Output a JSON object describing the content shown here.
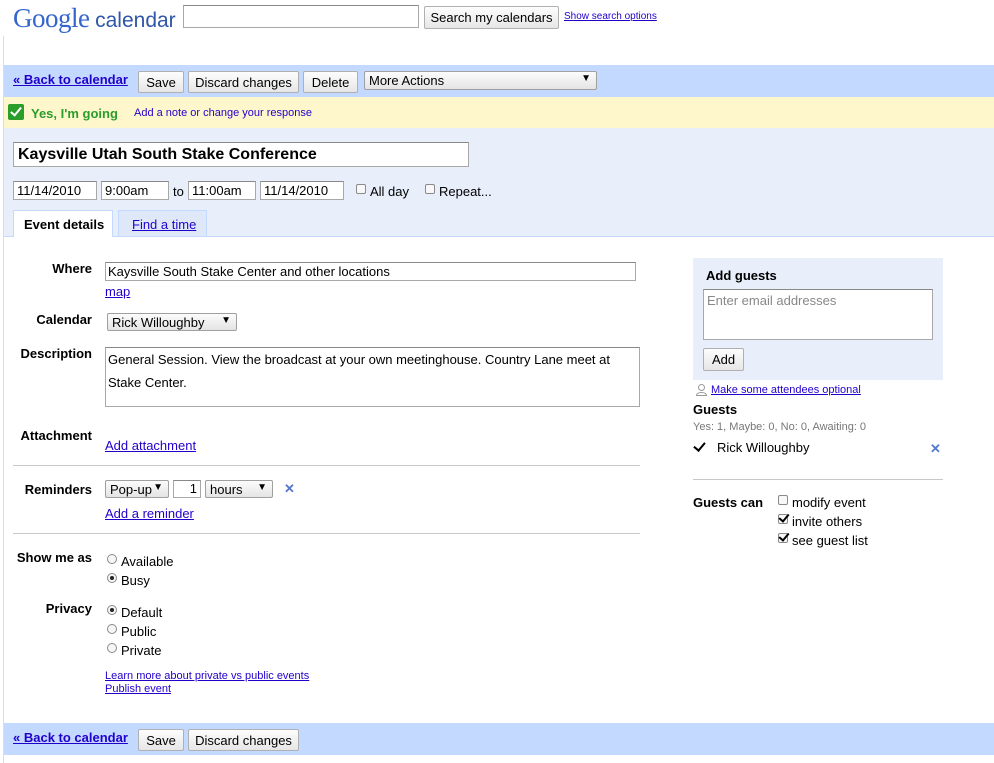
{
  "header": {
    "logo_google": "Google",
    "logo_calendar": "calendar",
    "search_value": "",
    "search_button": "Search my calendars",
    "show_search_options": "Show search options"
  },
  "toolbar": {
    "back": "« Back to calendar",
    "save": "Save",
    "discard": "Discard changes",
    "delete": "Delete",
    "more_actions": "More Actions"
  },
  "response": {
    "status": "Yes, I'm going",
    "change_link": "Add a note or change your response"
  },
  "event": {
    "title": "Kaysville Utah South Stake Conference",
    "start_date": "11/14/2010",
    "start_time": "9:00am",
    "to": "to",
    "end_time": "11:00am",
    "end_date": "11/14/2010",
    "all_day": "All day",
    "repeat": "Repeat..."
  },
  "tabs": [
    {
      "label": "Event details"
    },
    {
      "label": "Find a time"
    }
  ],
  "details": {
    "where_label": "Where",
    "where_value": "Kaysville South Stake Center and other locations",
    "map_link": "map",
    "calendar_label": "Calendar",
    "calendar_value": "Rick Willoughby",
    "description_label": "Description",
    "description_value": "General Session. View the broadcast at your own meetinghouse. Country Lane meet at Stake Center.",
    "attachment_label": "Attachment",
    "add_attachment": "Add attachment",
    "reminders_label": "Reminders",
    "reminder_type": "Pop-up",
    "reminder_amount": "1",
    "reminder_unit": "hours",
    "add_reminder": "Add a reminder",
    "show_me_as_label": "Show me as",
    "show_available": "Available",
    "show_busy": "Busy",
    "privacy_label": "Privacy",
    "privacy_default": "Default",
    "privacy_public": "Public",
    "privacy_private": "Private",
    "learn_more": "Learn more about private vs public events",
    "publish": "Publish event"
  },
  "guests": {
    "add_title": "Add guests",
    "email_placeholder": "Enter email addresses",
    "add_button": "Add",
    "make_optional": "Make some attendees optional",
    "heading": "Guests",
    "counts": "Yes: 1, Maybe: 0, No: 0, Awaiting: 0",
    "list": [
      {
        "name": "Rick Willoughby"
      }
    ],
    "guests_can_label": "Guests can",
    "modify": "modify event",
    "invite": "invite others",
    "see_list": "see guest list"
  },
  "bottom_toolbar": {
    "back": "« Back to calendar",
    "save": "Save",
    "discard": "Discard changes"
  },
  "colors": {
    "toolbar_bg": "#c3d9ff",
    "response_bg": "#fff7cc",
    "going_green": "#2a9d2a",
    "link_blue": "#2200cc"
  }
}
